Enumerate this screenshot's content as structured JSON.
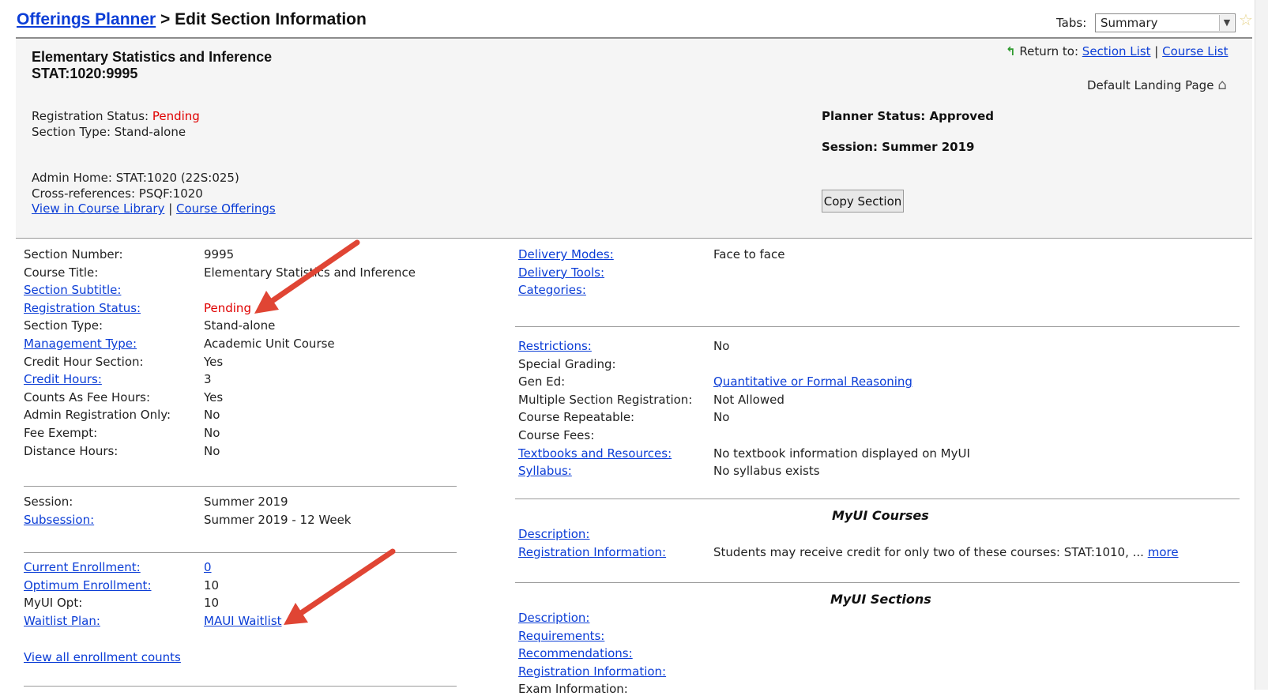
{
  "header": {
    "breadcrumb_link": "Offerings Planner",
    "breadcrumb_rest": " > Edit Section Information",
    "tabs_label": "Tabs:",
    "tabs_selected": "Summary"
  },
  "summary": {
    "course_title": "Elementary Statistics and Inference",
    "course_code": "STAT:1020:9995",
    "return_to_label": "Return to:",
    "return_links": [
      "Section List",
      "Course List"
    ],
    "link_separator": "|",
    "default_landing": "Default Landing Page",
    "registration_status_label": "Registration Status:",
    "registration_status_value": "Pending",
    "section_type_line": "Section Type: Stand-alone",
    "planner_status": "Planner Status: Approved",
    "session": "Session: Summer 2019",
    "admin_home": "Admin Home: STAT:1020 (22S:025)",
    "cross_refs": "Cross-references: PSQF:1020",
    "view_in_library": "View in Course Library",
    "course_offerings": "Course Offerings",
    "copy_button": "Copy Section"
  },
  "left_details": {
    "rows1": [
      {
        "label": "Section Number:",
        "value": "9995",
        "link": false
      },
      {
        "label": "Course Title:",
        "value": "Elementary Statistics and Inference",
        "link": false
      },
      {
        "label": "Section Subtitle:",
        "value": "",
        "link": true
      },
      {
        "label": "Registration Status:",
        "value": "Pending",
        "link": true
      },
      {
        "label": "Section Type:",
        "value": "Stand-alone",
        "link": false
      },
      {
        "label": "Management Type:",
        "value": "Academic Unit Course",
        "link": true
      },
      {
        "label": "Credit Hour Section:",
        "value": "Yes",
        "link": false
      },
      {
        "label": "Credit Hours:",
        "value": "3",
        "link": true
      },
      {
        "label": "Counts As Fee Hours:",
        "value": "Yes",
        "link": false
      },
      {
        "label": "Admin Registration Only:",
        "value": "No",
        "link": false
      },
      {
        "label": "Fee Exempt:",
        "value": "No",
        "link": false
      },
      {
        "label": "Distance Hours:",
        "value": "No",
        "link": false
      }
    ],
    "rows2": [
      {
        "label": "Session:",
        "value": "Summer 2019",
        "link": false
      },
      {
        "label": "Subsession:",
        "value": "Summer 2019 - 12 Week",
        "link": true
      }
    ],
    "rows3": [
      {
        "label": "Current Enrollment:",
        "value": "0",
        "link": true
      },
      {
        "label": "Optimum Enrollment:",
        "value": "10",
        "link": true
      },
      {
        "label": "MyUI Opt:",
        "value": "10",
        "link": false
      },
      {
        "label": "Waitlist Plan:",
        "value": "MAUI Waitlist",
        "link": true
      }
    ],
    "view_all_counts": "View all enrollment counts"
  },
  "right_details": {
    "rows1": [
      {
        "label": "Delivery Modes:",
        "value": "Face to face",
        "link": true
      },
      {
        "label": "Delivery Tools:",
        "value": "",
        "link": true
      },
      {
        "label": "Categories:",
        "value": "",
        "link": true
      }
    ],
    "rows2": [
      {
        "label": "Restrictions:",
        "value": "No",
        "link": true
      },
      {
        "label": "Special Grading:",
        "value": "",
        "link": false
      },
      {
        "label": "Gen Ed:",
        "value": "Quantitative or Formal Reasoning",
        "link": false
      },
      {
        "label": "Multiple Section Registration:",
        "value": "Not Allowed",
        "link": false
      },
      {
        "label": "Course Repeatable:",
        "value": "No",
        "link": false
      },
      {
        "label": "Course Fees:",
        "value": "",
        "link": false
      },
      {
        "label": "Textbooks and Resources:",
        "value": "No textbook information displayed on MyUI",
        "link": true
      },
      {
        "label": "Syllabus:",
        "value": "No syllabus exists",
        "link": true
      }
    ],
    "myui_courses_heading": "MyUI Courses",
    "myui_courses_rows": [
      {
        "label": "Description:",
        "value": ""
      },
      {
        "label": "Registration Information:",
        "value": "Students may receive credit for only two of these courses: STAT:1010, ..."
      }
    ],
    "more_link": "more",
    "myui_sections_heading": "MyUI Sections",
    "myui_sections_rows": [
      {
        "label": "Description:"
      },
      {
        "label": "Requirements:"
      },
      {
        "label": "Recommendations:"
      },
      {
        "label": "Registration Information:"
      },
      {
        "label": "Exam Information:"
      }
    ]
  },
  "colors": {
    "link": "#0b3dd6",
    "pending": "#e00000",
    "annotation_arrow": "#e04534",
    "panel_bg": "#f5f5f5"
  }
}
